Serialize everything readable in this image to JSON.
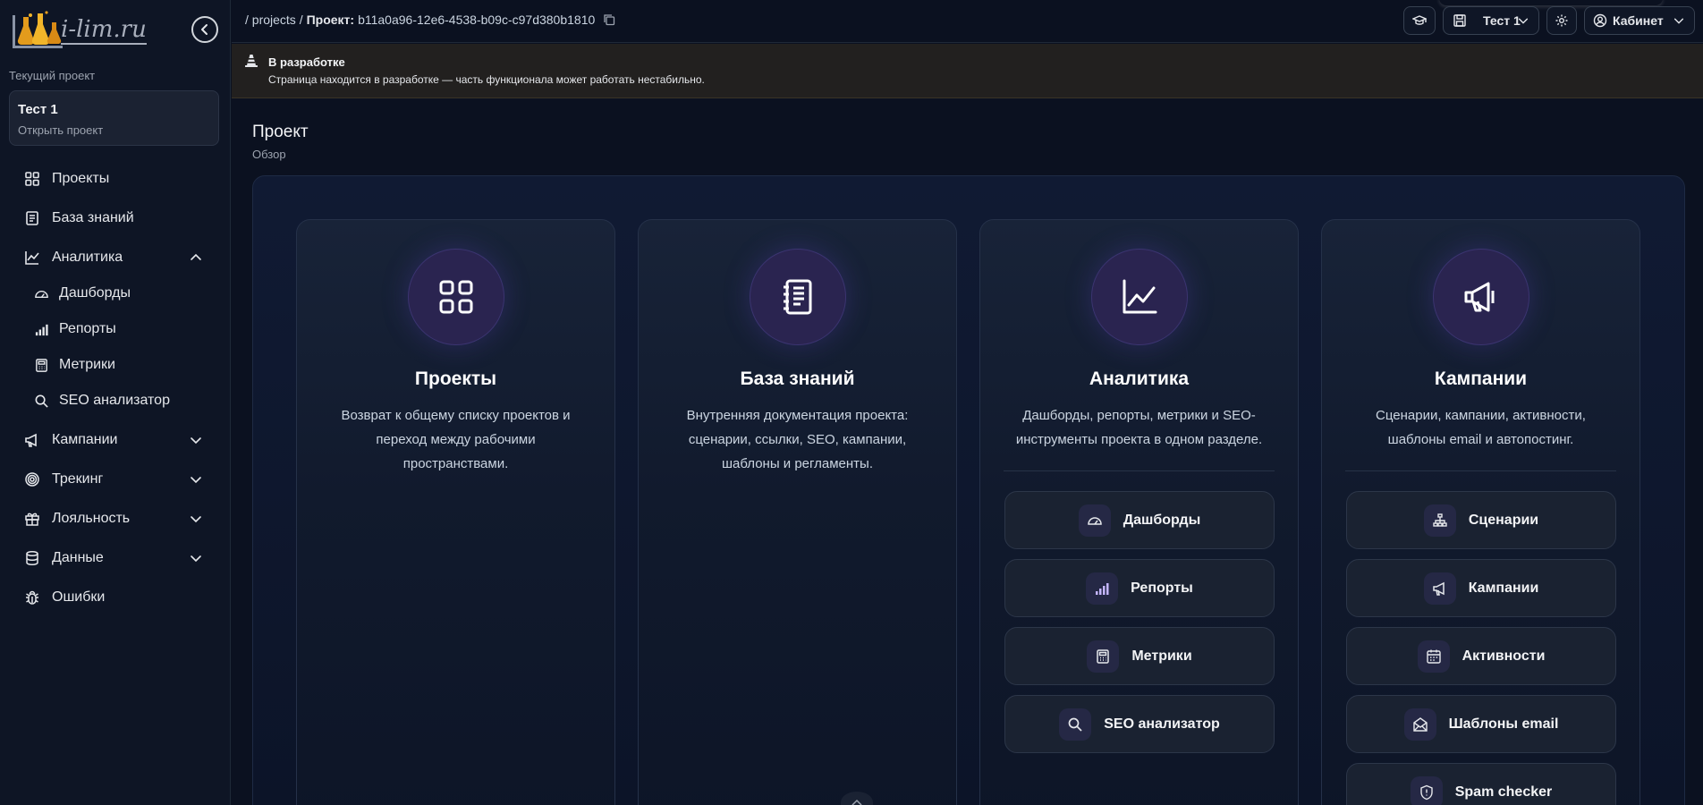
{
  "logo": {
    "text": "i-lim.ru"
  },
  "sidebar": {
    "current_label": "Текущий проект",
    "project": {
      "name": "Тест 1",
      "action": "Открыть проект"
    },
    "items": [
      {
        "label": "Проекты",
        "icon": "grid-icon"
      },
      {
        "label": "База знаний",
        "icon": "notebook-icon"
      },
      {
        "label": "Аналитика",
        "icon": "chart-line-icon",
        "expanded": true,
        "children": [
          {
            "label": "Дашборды",
            "icon": "gauge-icon"
          },
          {
            "label": "Репорты",
            "icon": "bar-chart-icon"
          },
          {
            "label": "Метрики",
            "icon": "calculator-icon"
          },
          {
            "label": "SEO анализатор",
            "icon": "search-icon"
          }
        ]
      },
      {
        "label": "Кампании",
        "icon": "megaphone-icon",
        "expanded": false
      },
      {
        "label": "Трекинг",
        "icon": "target-icon",
        "expanded": false
      },
      {
        "label": "Лояльность",
        "icon": "gift-icon",
        "expanded": false
      },
      {
        "label": "Данные",
        "icon": "database-icon",
        "expanded": false
      },
      {
        "label": "Ошибки",
        "icon": "bug-icon"
      }
    ]
  },
  "topbar": {
    "breadcrumb": {
      "root": "/ projects /",
      "label": "Проект:",
      "id": "b11a0a96-12e6-4538-b09c-c97d380b1810"
    },
    "project_select": "Тест 1",
    "account": "Кабинет"
  },
  "banner": {
    "title": "В разработке",
    "text": "Страница находится в разработке — часть функционала может работать нестабильно."
  },
  "page": {
    "title": "Проект",
    "subtitle": "Обзор"
  },
  "cards": [
    {
      "title": "Проекты",
      "icon": "grid-icon",
      "description": "Возврат к общему списку проектов и переход между рабочими пространствами.",
      "links": []
    },
    {
      "title": "База знаний",
      "icon": "notebook-icon",
      "description": "Внутренняя документация проекта: сценарии, ссылки, SEO, кампании, шаблоны и регламенты.",
      "links": []
    },
    {
      "title": "Аналитика",
      "icon": "chart-line-icon",
      "description": "Дашборды, репорты, метрики и SEO-инструменты проекта в одном разделе.",
      "links": [
        {
          "label": "Дашборды",
          "icon": "gauge-icon"
        },
        {
          "label": "Репорты",
          "icon": "bar-chart-icon"
        },
        {
          "label": "Метрики",
          "icon": "calculator-icon"
        },
        {
          "label": "SEO анализатор",
          "icon": "search-icon"
        }
      ]
    },
    {
      "title": "Кампании",
      "icon": "megaphone-icon",
      "description": "Сценарии, кампании, активности, шаблоны email и автопостинг.",
      "links": [
        {
          "label": "Сценарии",
          "icon": "sitemap-icon"
        },
        {
          "label": "Кампании",
          "icon": "megaphone-icon"
        },
        {
          "label": "Активности",
          "icon": "calendar-icon"
        },
        {
          "label": "Шаблоны email",
          "icon": "mail-open-icon"
        },
        {
          "label": "Spam checker",
          "icon": "shield-icon"
        }
      ]
    }
  ],
  "colors": {
    "accent": "#2a2450",
    "background": "#0b1120",
    "banner": "#22201f"
  }
}
